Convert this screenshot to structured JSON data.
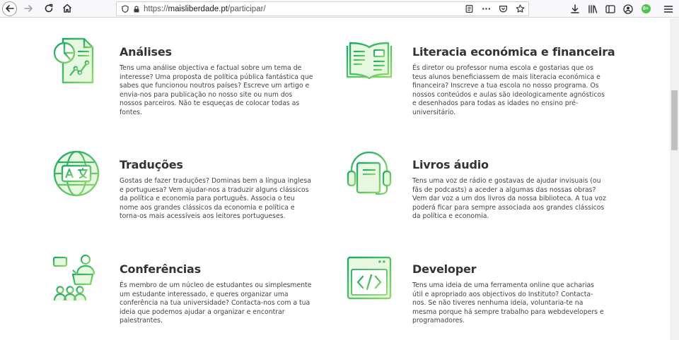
{
  "browser": {
    "url_scheme": "https://",
    "url_host": "maisliberdade.pt",
    "url_path": "/participar/",
    "account_badge": "8+"
  },
  "accent_color": "#3ec070",
  "cards": [
    {
      "title": "Análises",
      "icon": "analytics-report-icon",
      "description": "Tens uma análise objectiva e factual sobre um tema de interesse? Uma proposta de política pública fantástica que sabes que funcionou noutros países? Escreve um artigo e envia-nos para publicação no nosso site ou num dos nossos parceiros. Não te esqueças de colocar todas as fontes."
    },
    {
      "title": "Literacia económica e financeira",
      "icon": "open-book-icon",
      "description": "És diretor ou professor numa escola e gostarias que os teus alunos beneficiassem de mais literacia económica e financeira? Inscreve a tua escola no nosso programa. Os nossos conteúdos e aulas são ideologicamente agnósticos e desenhados para todas as idades no ensino pré-universitário."
    },
    {
      "title": "Traduções",
      "icon": "translation-globe-icon",
      "description": "Gostas de fazer traduções? Dominas bem a língua inglesa e portuguesa? Vem ajudar-nos a traduzir alguns clássicos da política e economia para português. Associa o teu nome aos grandes clássicos da economia e política e torna-os mais acessíveis aos leitores portugueses."
    },
    {
      "title": "Livros áudio",
      "icon": "audiobook-headphones-icon",
      "description": "Tens uma voz de rádio e gostavas de ajudar invisuais (ou fãs de podcasts) a aceder a algumas das nossas obras? Vem dar voz a um dos livros da nossa biblioteca. A tua voz poderá ficar para sempre associada aos grandes clássicos da política e economia."
    },
    {
      "title": "Conferências",
      "icon": "conference-speaker-icon",
      "description": "És membro de um núcleo de estudantes ou simplesmente um estudante interessado, e queres organizar uma conferência na tua universidade? Contacta-nos com a tua ideia que podemos ajudar a organizar e encontrar palestrantes."
    },
    {
      "title": "Developer",
      "icon": "code-window-icon",
      "description": "Tens uma ideia de uma ferramenta online que acharias útil e apropriado aos objectivos do Instituto? Contacta-nos. Se não tiveres nenhuma ideia, voluntaria-te na mesma porque há sempre trabalho para webdevelopers e programadores."
    }
  ]
}
